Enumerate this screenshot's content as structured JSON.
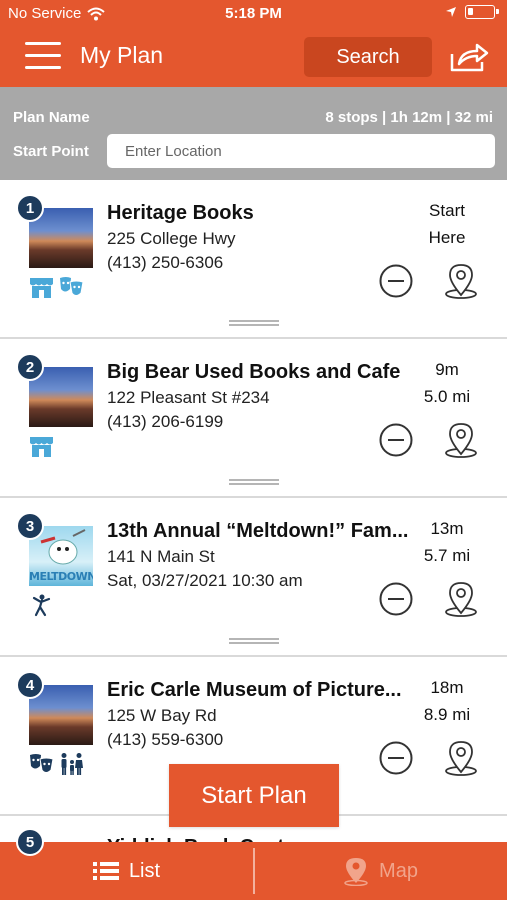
{
  "status_bar": {
    "carrier": "No Service",
    "time": "5:18 PM"
  },
  "header": {
    "title": "My Plan",
    "search_label": "Search"
  },
  "plan": {
    "name_label": "Plan Name",
    "stats": "8 stops | 1h 12m | 32 mi",
    "start_label": "Start Point",
    "location_placeholder": "Enter Location"
  },
  "stops": [
    {
      "number": "1",
      "name": "Heritage Books",
      "address": "225 College Hwy",
      "extra": "(413) 250-6306",
      "eta": "Start",
      "distance": "Here",
      "icons": [
        "shop-icon",
        "theater-icon"
      ]
    },
    {
      "number": "2",
      "name": "Big Bear Used Books and Cafe",
      "address": "122 Pleasant St #234",
      "extra": "(413) 206-6199",
      "eta": "9m",
      "distance": "5.0 mi",
      "icons": [
        "shop-icon"
      ]
    },
    {
      "number": "3",
      "name": "13th Annual “Meltdown!” Fam...",
      "address": "141 N Main St",
      "extra": "Sat, 03/27/2021 10:30 am",
      "eta": "13m",
      "distance": "5.7 mi",
      "thumb_text": "MELTDOWN",
      "icons": [
        "event-person-icon"
      ]
    },
    {
      "number": "4",
      "name": "Eric Carle Museum of Picture...",
      "address": "125 W Bay Rd",
      "extra": "(413) 559-6300",
      "eta": "18m",
      "distance": "8.9 mi",
      "icons": [
        "theater-icon",
        "family-icon"
      ]
    }
  ],
  "peek_stop": {
    "number": "5",
    "name": "Yiddish Book Center"
  },
  "start_plan_label": "Start Plan",
  "tabs": {
    "list_label": "List",
    "map_label": "Map"
  },
  "colors": {
    "brand": "#e4572e",
    "badge": "#1d3b5c",
    "panel": "#a8a8a8",
    "category_icon": "#4aa8d8"
  }
}
